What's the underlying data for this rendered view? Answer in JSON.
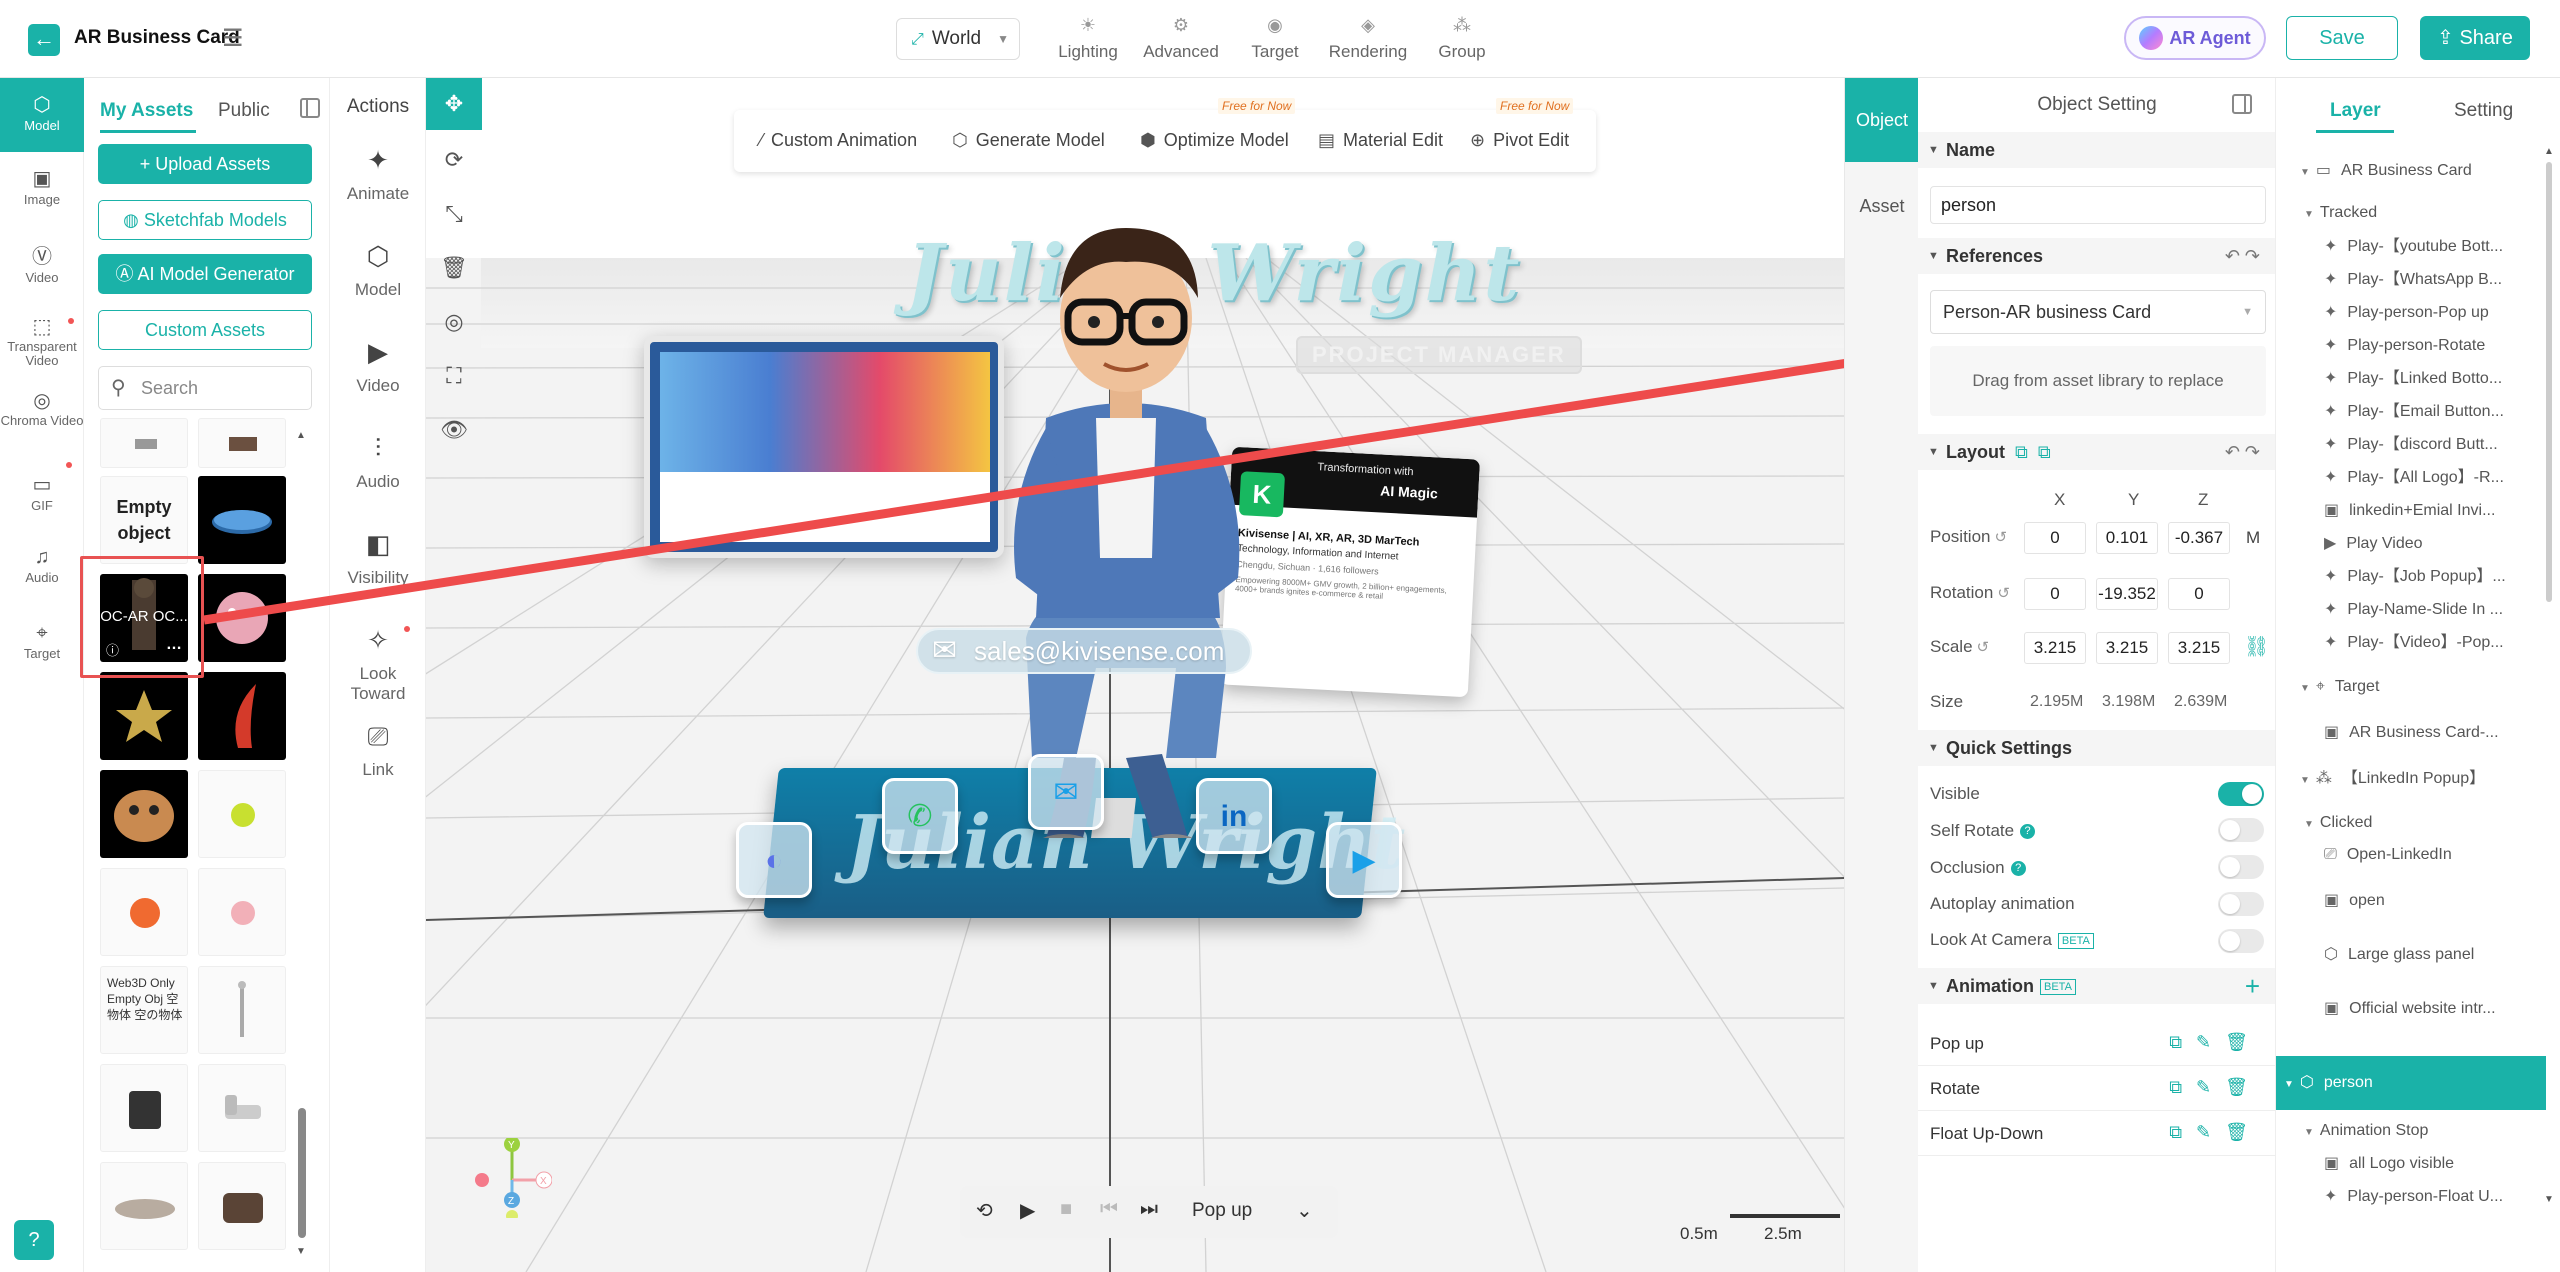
{
  "header": {
    "title": "AR Business Card",
    "world_label": "World",
    "menu": [
      "Lighting",
      "Advanced",
      "Target",
      "Rendering",
      "Group"
    ],
    "ar_agent": "AR Agent",
    "save": "Save",
    "share": "Share"
  },
  "rail": {
    "items": [
      "Model",
      "Image",
      "Video",
      "Transparent Video",
      "Chroma Video",
      "GIF",
      "Audio",
      "Target"
    ]
  },
  "assets": {
    "tab_my": "My Assets",
    "tab_public": "Public",
    "upload": "Upload Assets",
    "sketchfab": "Sketchfab Models",
    "ai_gen": "AI Model Generator",
    "custom": "Custom Assets",
    "search_placeholder": "Search",
    "empty_object": "Empty object",
    "oc_label": "OC-AR OC...",
    "web3d": "Web3D Only Empty Obj 空物体 空の物体"
  },
  "actions": {
    "title": "Actions",
    "items": [
      "Animate",
      "Model",
      "Video",
      "Audio",
      "Visibility",
      "Look Toward",
      "Link"
    ]
  },
  "context_bar": {
    "items": [
      "Custom Animation",
      "Generate Model",
      "Optimize Model",
      "Material Edit",
      "Pivot Edit"
    ],
    "free_badge": "Free for Now"
  },
  "scene": {
    "name": "Julian Wright",
    "subtitle": "PROJECT MANAGER",
    "email": "sales@kivisense.com",
    "card_logo": "K",
    "card_header_top": "Transformation with",
    "card_header_brand": "AI Magic",
    "card_line1": "Kivisense | AI, XR, AR, 3D MarTech",
    "card_line2": "Technology, Information and Internet",
    "card_line3": "Chengdu, Sichuan · 1,616 followers",
    "card_line4": "Empowering 8000M+ GMV growth, 2 billion+ engagements, 4000+ brands ignites e-commerce & retail"
  },
  "playback": {
    "animation": "Pop up"
  },
  "scale_bar": {
    "small": "0.5m",
    "large": "2.5m"
  },
  "side_tabs": {
    "object": "Object",
    "asset": "Asset"
  },
  "settings": {
    "title": "Object Setting",
    "name_section": "Name",
    "name_value": "person",
    "references_section": "References",
    "reference_value": "Person-AR business Card",
    "dropzone": "Drag from asset library to replace",
    "layout_section": "Layout",
    "axes": [
      "X",
      "Y",
      "Z"
    ],
    "position_label": "Position",
    "position": [
      "0",
      "0.101",
      "-0.367"
    ],
    "position_unit": "M",
    "rotation_label": "Rotation",
    "rotation": [
      "0",
      "-19.352",
      "0"
    ],
    "scale_label": "Scale",
    "scale": [
      "3.215",
      "3.215",
      "3.215"
    ],
    "size_label": "Size",
    "size": [
      "2.195M",
      "3.198M",
      "2.639M"
    ],
    "quick_section": "Quick Settings",
    "quick": [
      {
        "label": "Visible",
        "on": true
      },
      {
        "label": "Self Rotate",
        "on": false
      },
      {
        "label": "Occlusion",
        "on": false
      },
      {
        "label": "Autoplay animation",
        "on": false
      },
      {
        "label": "Look At Camera",
        "on": false
      }
    ],
    "beta": "BETA",
    "animation_section": "Animation",
    "animations": [
      "Pop up",
      "Rotate",
      "Float Up-Down"
    ]
  },
  "layer": {
    "tab_layer": "Layer",
    "tab_setting": "Setting",
    "rows": [
      "AR Business Card",
      "Tracked",
      "Play-【youtube Bott...",
      "Play-【WhatsApp B...",
      "Play-person-Pop up",
      "Play-person-Rotate",
      "Play-【Linked Botto...",
      "Play-【Email Button...",
      "Play-【discord Butt...",
      "Play-【All Logo】-R...",
      "linkedin+Emial Invi...",
      "Play Video",
      "Play-【Job Popup】...",
      "Play-Name-Slide In ...",
      "Play-【Video】-Pop...",
      "Target",
      "AR Business Card-...",
      "【LinkedIn Popup】",
      "Clicked",
      "Open-LinkedIn",
      "open",
      "Large glass panel",
      "Official website intr...",
      "person",
      "Animation Stop",
      "all Logo visible",
      "Play-person-Float U..."
    ]
  }
}
